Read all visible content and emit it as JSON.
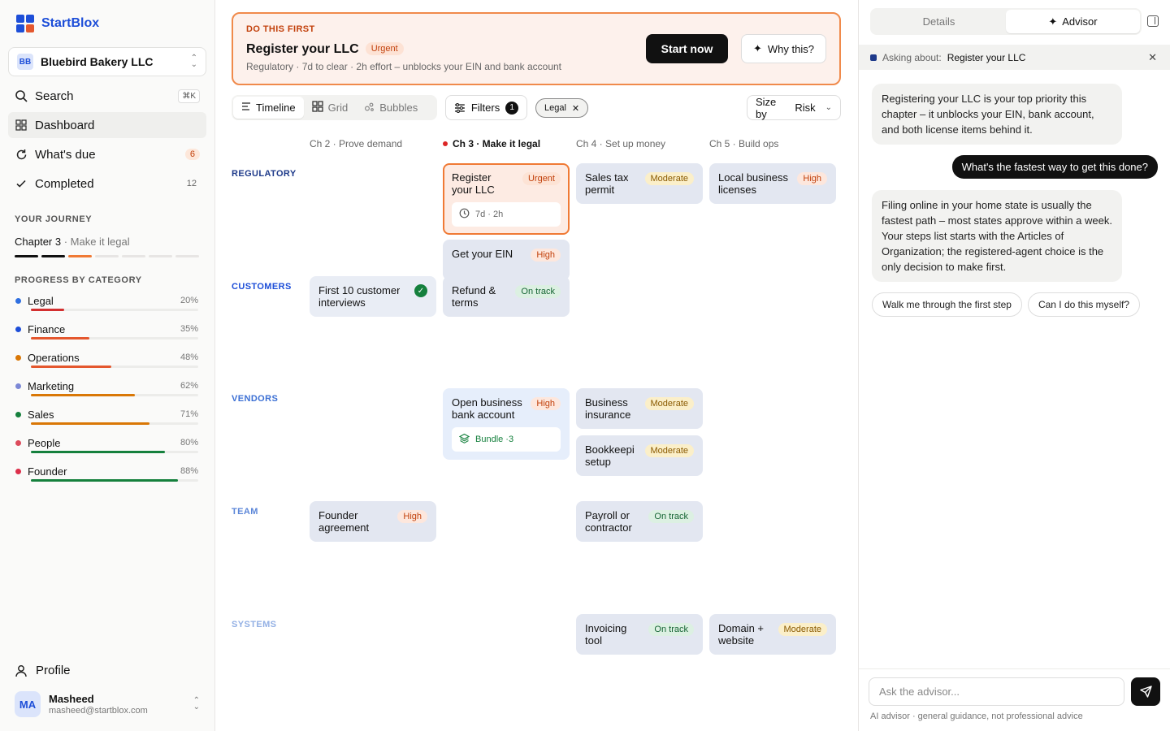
{
  "app": {
    "name": "StartBlox",
    "brand_color": "#1d4ed8"
  },
  "sidebar": {
    "company": {
      "initials": "BB",
      "name": "Bluebird Bakery LLC"
    },
    "nav": [
      {
        "label": "Search",
        "icon": "search-icon",
        "shortcut": "⌘K"
      },
      {
        "label": "Dashboard",
        "icon": "grid-icon",
        "active": true
      },
      {
        "label": "What's due",
        "icon": "refresh-icon",
        "count": "6"
      },
      {
        "label": "Completed",
        "icon": "check-icon",
        "count": "12"
      }
    ],
    "journey_title": "YOUR JOURNEY",
    "journey": {
      "chapter": "Chapter 3",
      "subtitle": "· Make it legal"
    },
    "categories_title": "PROGRESS BY CATEGORY",
    "categories": [
      {
        "name": "Legal",
        "pct": "20%",
        "value": 0.2,
        "dot": "#2f6fe0",
        "bar": "#d32f2f"
      },
      {
        "name": "Finance",
        "pct": "35%",
        "value": 0.35,
        "dot": "#1d4ed8",
        "bar": "#e4572e"
      },
      {
        "name": "Operations",
        "pct": "48%",
        "value": 0.48,
        "dot": "#d97706",
        "bar": "#e4572e"
      },
      {
        "name": "Marketing",
        "pct": "62%",
        "value": 0.62,
        "dot": "#7c88d6",
        "bar": "#d97706"
      },
      {
        "name": "Sales",
        "pct": "71%",
        "value": 0.71,
        "dot": "#15803d",
        "bar": "#d97706"
      },
      {
        "name": "People",
        "pct": "80%",
        "value": 0.8,
        "dot": "#dc4b5c",
        "bar": "#15803d"
      },
      {
        "name": "Founder",
        "pct": "88%",
        "value": 0.88,
        "dot": "#dc2f4b",
        "bar": "#15803d"
      }
    ],
    "profile_label": "Profile",
    "user": {
      "initials": "MA",
      "name": "Masheed",
      "email": "masheed@startblox.com"
    }
  },
  "banner": {
    "kicker": "DO THIS FIRST",
    "title": "Register your LLC",
    "badge": "Urgent",
    "meta": "Regulatory · 7d to clear · 2h effort – unblocks your EIN and bank account",
    "primary": "Start now",
    "secondary": "Why this?"
  },
  "toolbar": {
    "views": [
      {
        "label": "Timeline",
        "icon": "list-icon",
        "active": true
      },
      {
        "label": "Grid",
        "icon": "grid-icon"
      },
      {
        "label": "Bubbles",
        "icon": "bubbles-icon"
      }
    ],
    "filters_label": "Filters",
    "filters_count": "1",
    "chip": "Legal",
    "sizeby_label": "Size by",
    "sizeby_value": "Risk"
  },
  "board": {
    "columns": [
      {
        "label": "Ch 2 · Prove demand"
      },
      {
        "label": "Ch 3 · Make it legal",
        "current": true
      },
      {
        "label": "Ch 4 · Set up money"
      },
      {
        "label": "Ch 5 · Build ops"
      }
    ],
    "rows": [
      {
        "label": "REGULATORY",
        "color": "#1e3a8a"
      },
      {
        "label": "CUSTOMERS",
        "color": "#1d4ed8"
      },
      {
        "label": "VENDORS",
        "color": "#3b6fd4"
      },
      {
        "label": "TEAM",
        "color": "#5b86d8"
      },
      {
        "label": "SYSTEMS",
        "color": "#93b0e4"
      }
    ],
    "cards": [
      {
        "row": 0,
        "col": 1,
        "slot": 0,
        "title": "Register\nyour LLC",
        "tag": "Urgent",
        "tone": "urgent",
        "sub": "7d · 2h",
        "sub_icon": "clock-icon",
        "highlight": true
      },
      {
        "row": 0,
        "col": 1,
        "slot": 1,
        "title": "Get your EIN",
        "tag": "High",
        "tone": "high"
      },
      {
        "row": 0,
        "col": 2,
        "slot": 0,
        "title": "Sales tax\npermit",
        "tag": "Moderate",
        "tone": "moderate"
      },
      {
        "row": 0,
        "col": 3,
        "slot": 0,
        "title": "Local business\nlicenses",
        "tag": "High",
        "tone": "high"
      },
      {
        "row": 1,
        "col": 0,
        "slot": 0,
        "title": "First 10 customer\ninterviews",
        "done": true
      },
      {
        "row": 1,
        "col": 1,
        "slot": 0,
        "title": "Refund &\nterms",
        "tag": "On track",
        "tone": "ontrack"
      },
      {
        "row": 2,
        "col": 1,
        "slot": 0,
        "title": "Open business\nbank account",
        "tag": "High",
        "tone": "high",
        "sub": "Bundle ·3",
        "sub_icon": "layers-icon",
        "sub_green": true
      },
      {
        "row": 2,
        "col": 2,
        "slot": 0,
        "title": "Business\ninsurance",
        "tag": "Moderate",
        "tone": "moderate"
      },
      {
        "row": 2,
        "col": 2,
        "slot": 1,
        "title": "Bookkeepi\nsetup",
        "tag": "Moderate",
        "tone": "moderate"
      },
      {
        "row": 3,
        "col": 0,
        "slot": 0,
        "title": "Founder\nagreement",
        "tag": "High",
        "tone": "high"
      },
      {
        "row": 3,
        "col": 2,
        "slot": 0,
        "title": "Payroll or\ncontractor",
        "tag": "On track",
        "tone": "ontrack"
      },
      {
        "row": 4,
        "col": 2,
        "slot": 0,
        "title": "Invoicing\ntool",
        "tag": "On track",
        "tone": "ontrack"
      },
      {
        "row": 4,
        "col": 3,
        "slot": 0,
        "title": "Domain +\nwebsite",
        "tag": "Moderate",
        "tone": "moderate"
      }
    ]
  },
  "panel": {
    "tabs": [
      {
        "label": "Details"
      },
      {
        "label": "Advisor",
        "icon": "sparkle-icon",
        "active": true
      }
    ],
    "context_prefix": "Asking about:",
    "context_item": "Register your LLC",
    "messages": [
      {
        "role": "ai",
        "text": "Registering your LLC is your top priority this chapter – it unblocks your EIN, bank account, and both license items behind it."
      },
      {
        "role": "user",
        "text": "What's the fastest way to get this done?"
      },
      {
        "role": "ai",
        "text": "Filing online in your home state is usually the fastest path – most states approve within a week. Your steps list starts with the Articles of Organization; the registered-agent choice is the only decision to make first."
      }
    ],
    "suggestions": [
      "Walk me through the first step",
      "Can I do this myself?"
    ],
    "input_placeholder": "Ask the advisor...",
    "disclaimer": "AI advisor · general guidance, not professional advice"
  }
}
